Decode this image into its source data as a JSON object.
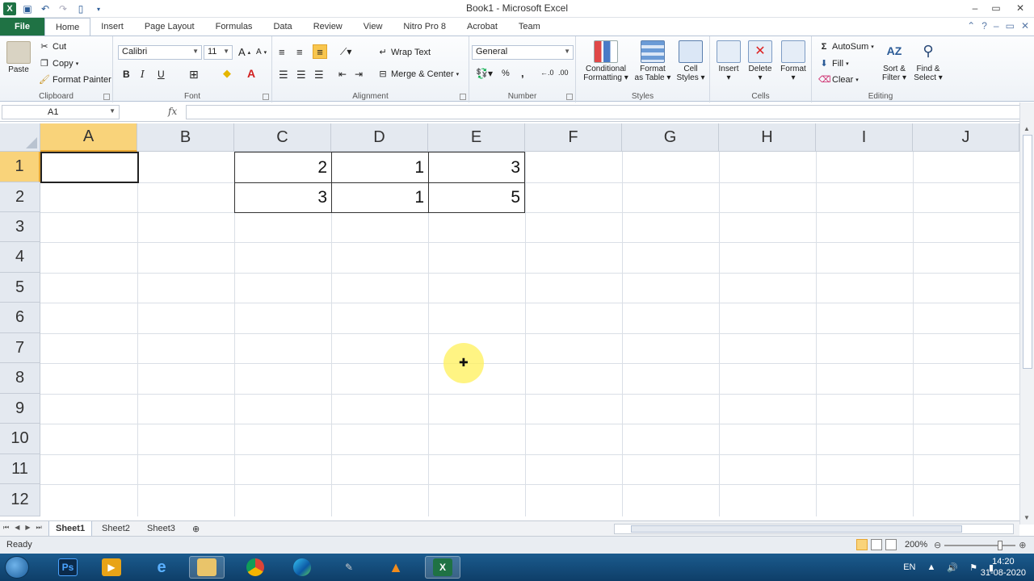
{
  "window": {
    "title": "Book1 - Microsoft Excel",
    "controls": {
      "minimize": "–",
      "maximize": "▭",
      "close": "✕"
    }
  },
  "ribbon_tabs": [
    "File",
    "Home",
    "Insert",
    "Page Layout",
    "Formulas",
    "Data",
    "Review",
    "View",
    "Nitro Pro 8",
    "Acrobat",
    "Team"
  ],
  "clipboard": {
    "paste": "Paste",
    "cut": "Cut",
    "copy": "Copy",
    "format_painter": "Format Painter",
    "label": "Clipboard"
  },
  "font": {
    "name": "Calibri",
    "size": "11",
    "grow": "A",
    "shrink": "A",
    "bold": "B",
    "italic": "I",
    "underline": "U",
    "label": "Font"
  },
  "alignment": {
    "wrap_text": "Wrap Text",
    "merge_center": "Merge & Center",
    "label": "Alignment"
  },
  "number": {
    "format": "General",
    "percent": "%",
    "comma": ",",
    "label": "Number"
  },
  "styles": {
    "conditional_formatting_1": "Conditional",
    "conditional_formatting_2": "Formatting",
    "format_as_table_1": "Format",
    "format_as_table_2": "as Table",
    "cell_styles_1": "Cell",
    "cell_styles_2": "Styles",
    "label": "Styles"
  },
  "cells": {
    "insert": "Insert",
    "delete": "Delete",
    "format": "Format",
    "label": "Cells"
  },
  "editing": {
    "autosum": "AutoSum",
    "fill": "Fill",
    "clear": "Clear",
    "sort_filter_1": "Sort &",
    "sort_filter_2": "Filter",
    "find_select_1": "Find &",
    "find_select_2": "Select",
    "label": "Editing"
  },
  "formula_bar": {
    "name_box": "A1",
    "fx": "fx",
    "value": ""
  },
  "grid": {
    "columns": [
      "A",
      "B",
      "C",
      "D",
      "E",
      "F",
      "G",
      "H",
      "I",
      "J"
    ],
    "rows": [
      "1",
      "2",
      "3",
      "4",
      "5",
      "6",
      "7",
      "8",
      "9",
      "10",
      "11",
      "12"
    ],
    "selected_cell": "A1",
    "cells": {
      "C1": "2",
      "D1": "1",
      "E1": "3",
      "C2": "3",
      "D2": "1",
      "E2": "5"
    }
  },
  "sheets": [
    "Sheet1",
    "Sheet2",
    "Sheet3"
  ],
  "active_sheet": "Sheet1",
  "status": {
    "ready": "Ready",
    "zoom": "200%"
  },
  "taskbar": {
    "language": "EN",
    "time": "14:20",
    "date": "31-08-2020"
  }
}
